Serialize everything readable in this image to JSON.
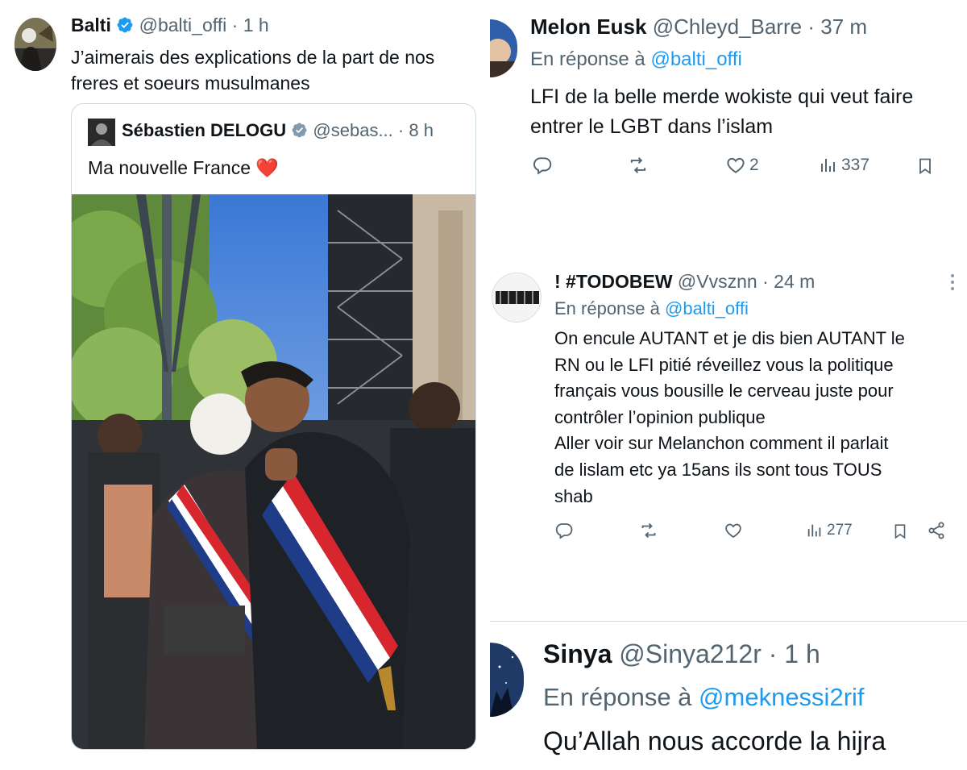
{
  "left": {
    "name": "Balti",
    "handle": "@balti_offi",
    "time": "1 h",
    "text": "J’aimerais des explications de la part de nos freres et soeurs musulmanes",
    "quote": {
      "name": "Sébastien DELOGU",
      "handle": "@sebas...",
      "time": "8 h",
      "text": "Ma nouvelle France",
      "emoji": "❤️"
    }
  },
  "r1": {
    "name": "Melon Eusk",
    "handle": "@Chleyd_Barre",
    "time": "37 m",
    "reply_prefix": "En réponse à",
    "reply_to": "@balti_offi",
    "text": "LFI de la belle merde wokiste qui veut faire entrer le LGBT dans l’islam",
    "likes": "2",
    "views": "337"
  },
  "r2": {
    "name": "! #TODOBEW",
    "handle": "@Vvsznn",
    "time": "24 m",
    "reply_prefix": "En réponse à",
    "reply_to": "@balti_offi",
    "text_lines": [
      "On encule AUTANT et je dis bien AUTANT le",
      "RN ou le LFI pitié réveillez vous la politique",
      "français vous bousille le  cerveau juste pour",
      "contrôler l’opinion publique",
      "Aller voir sur Melanchon comment il parlait",
      "de lislam etc ya 15ans ils sont tous TOUS",
      "shab"
    ],
    "views": "277"
  },
  "r3": {
    "name": "Sinya",
    "handle": "@Sinya212r",
    "time": "1 h",
    "reply_prefix": "En réponse à",
    "reply_to": "@meknessi2rif",
    "text": "Qu’Allah nous accorde la hijra"
  },
  "colors": {
    "text": "#0f1419",
    "secondary": "#536471",
    "link": "#1d9bf0",
    "verified": "#1d9bf0",
    "border": "#cfd9de"
  }
}
